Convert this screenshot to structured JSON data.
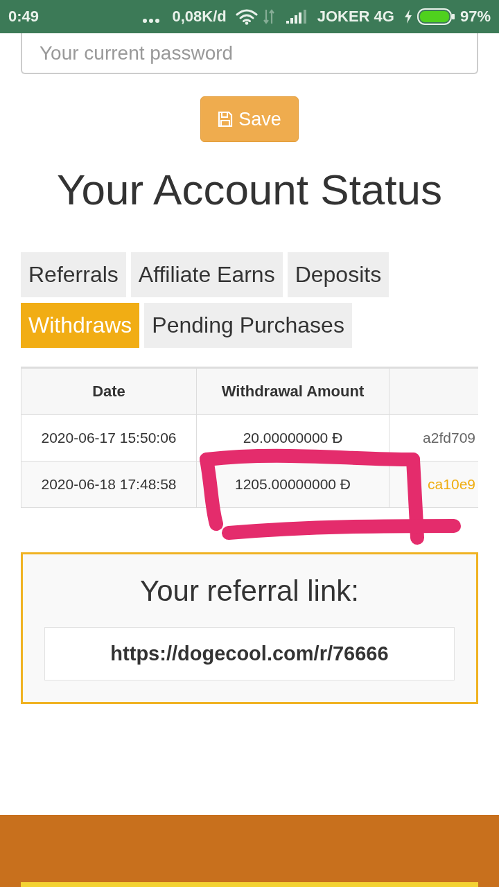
{
  "status_bar": {
    "time": "0:49",
    "speed": "0,08K/d",
    "carrier": "JOKER 4G",
    "battery": "97%"
  },
  "password_field": {
    "placeholder": "Your current password"
  },
  "save_button": {
    "label": "Save"
  },
  "heading": "Your Account Status",
  "tabs": [
    {
      "label": "Referrals",
      "selected": false
    },
    {
      "label": "Affiliate Earns",
      "selected": false
    },
    {
      "label": "Deposits",
      "selected": false
    },
    {
      "label": "Withdraws",
      "selected": true
    },
    {
      "label": "Pending Purchases",
      "selected": false
    }
  ],
  "table": {
    "columns": [
      "Date",
      "Withdrawal Amount"
    ],
    "rows": [
      {
        "date": "2020-06-17 15:50:06",
        "amount": "20.00000000 Ð",
        "column_3": {
          "text": "a2fd709",
          "kind": "plain"
        }
      },
      {
        "date": "2020-06-18 17:48:58",
        "amount": "1205.00000000 Ð",
        "column_3": {
          "text": "ca10e9",
          "kind": "link"
        }
      }
    ]
  },
  "annotation": {
    "kind": "freehand-box"
  },
  "referral": {
    "title": "Your referral link:",
    "link": "https://dogecool.com/r/76666"
  }
}
